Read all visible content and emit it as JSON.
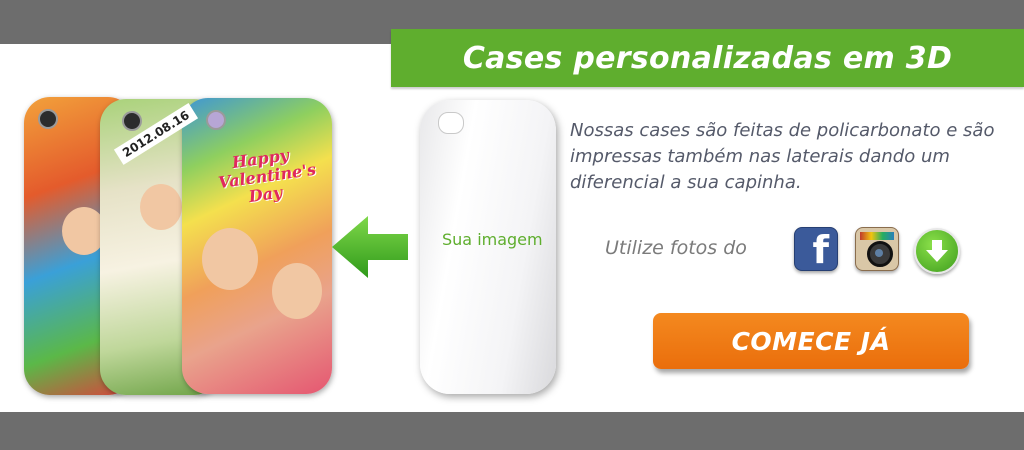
{
  "banner": {
    "title": "Cases personalizadas em 3D"
  },
  "showcase": {
    "date_tag": "2012.08.16",
    "valentine_text": "Happy Valentine's Day"
  },
  "blank_case": {
    "label": "Sua imagem"
  },
  "description": {
    "text": "Nossas cases são feitas de policarbonato e são impressas também nas laterais dando um diferencial a sua capinha."
  },
  "sources": {
    "label": "Utilize fotos do",
    "icons": [
      "facebook-icon",
      "instagram-icon",
      "download-icon"
    ]
  },
  "cta": {
    "label": "COMECE JÁ"
  },
  "colors": {
    "brand_green": "#5fae2e",
    "cta_orange": "#ea6e0c",
    "frame_gray": "#6d6d6d"
  }
}
